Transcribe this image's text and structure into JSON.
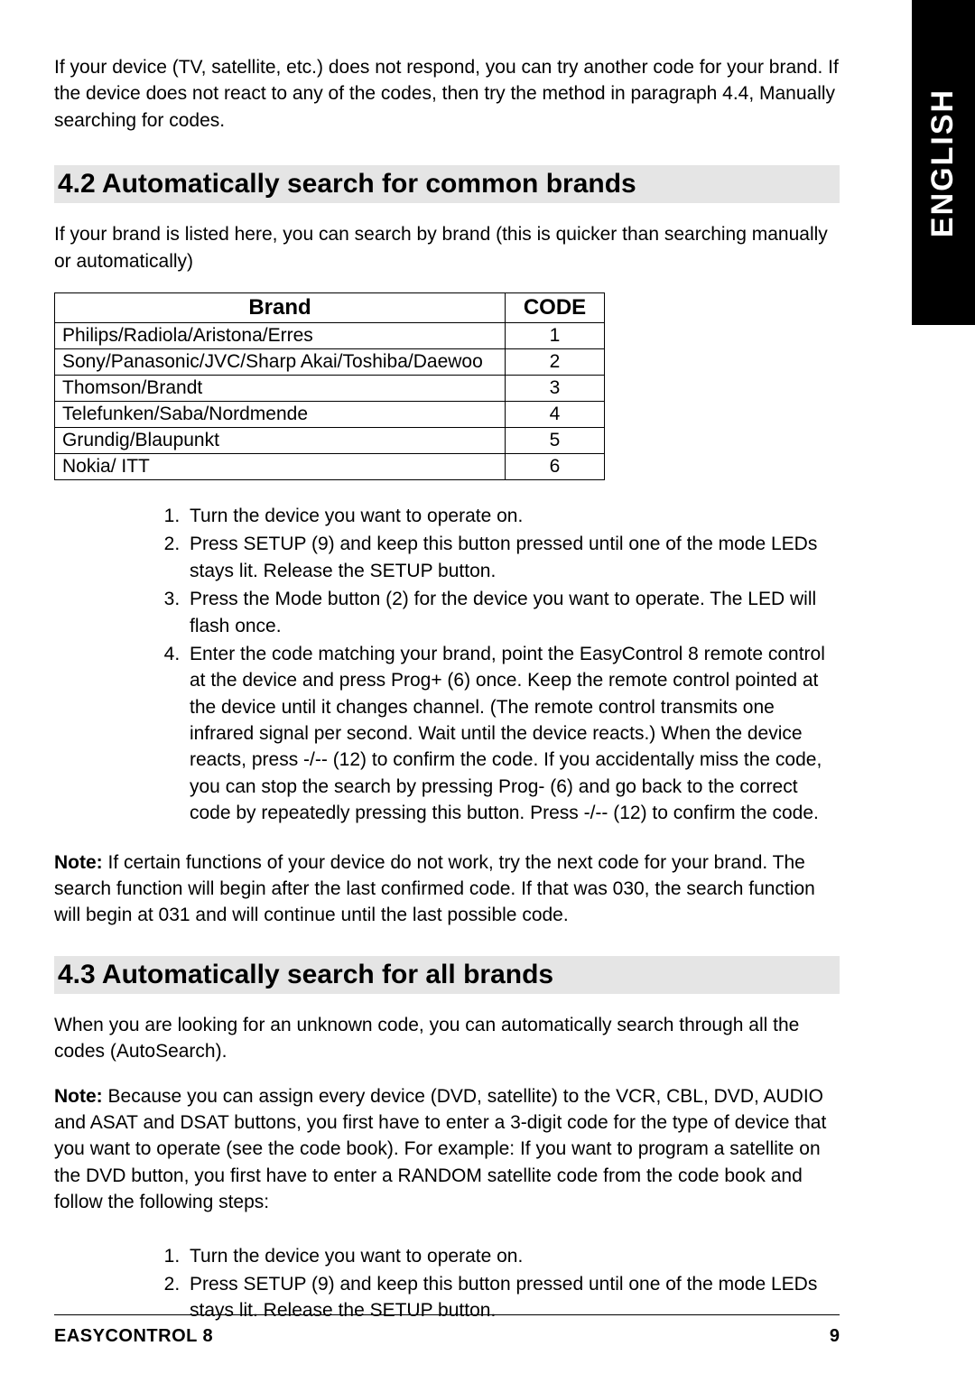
{
  "side_tab": "ENGLISH",
  "intro": "If your device (TV, satellite, etc.) does not respond, you can try another code for your brand. If the device does not react to any of the codes, then try the method in paragraph 4.4, Manually searching for codes.",
  "section_4_2": {
    "heading": "4.2 Automatically search for common brands",
    "intro": "If your brand is listed here, you can search by brand (this is quicker than searching manually or automatically)",
    "table": {
      "headers": {
        "brand": "Brand",
        "code": "CODE"
      },
      "rows": [
        {
          "brand": "Philips/Radiola/Aristona/Erres",
          "code": "1"
        },
        {
          "brand": "Sony/Panasonic/JVC/Sharp Akai/Toshiba/Daewoo",
          "code": "2"
        },
        {
          "brand": "Thomson/Brandt",
          "code": "3"
        },
        {
          "brand": "Telefunken/Saba/Nordmende",
          "code": "4"
        },
        {
          "brand": "Grundig/Blaupunkt",
          "code": "5"
        },
        {
          "brand": "Nokia/ ITT",
          "code": "6"
        }
      ]
    },
    "steps": [
      "Turn the device you want to operate on.",
      "Press SETUP (9) and keep this button pressed until one of the mode LEDs stays lit. Release the SETUP button.",
      "Press the Mode button (2) for the device you want to operate. The LED will flash once.",
      "Enter the code matching your brand, point the EasyControl 8 remote control at the device and press Prog+ (6) once. Keep the remote control pointed at the device until it changes channel. (The remote control transmits one infrared signal per second. Wait until the device reacts.) When the device reacts, press -/-- (12) to confirm the code. If you accidentally miss the code, you can stop the search by pressing Prog- (6) and go back to the correct code by repeatedly pressing this button. Press -/-- (12) to confirm the code."
    ],
    "note_label": "Note:",
    "note": " If certain functions of your device do not work, try the next code for your brand. The search function will begin after the last confirmed code. If that was 030, the search function will begin at 031 and will continue until the last possible code."
  },
  "section_4_3": {
    "heading": "4.3 Automatically search for all brands",
    "intro": "When you are looking for an unknown code, you can automatically search through all the codes (AutoSearch).",
    "note_label": "Note:",
    "note": " Because you can assign every device (DVD, satellite) to the VCR, CBL, DVD, AUDIO and ASAT and DSAT buttons, you first have to enter a 3-digit code for the type of device that you want to operate (see the code book). For example: If you want to program a satellite on the DVD button, you first have to enter a RANDOM satellite code from the code book and follow the following steps:",
    "steps": [
      "Turn the device you want to operate on.",
      "Press SETUP (9) and keep this button pressed until one of the mode LEDs stays lit. Release the SETUP button."
    ]
  },
  "footer": {
    "left": "EASYCONTROL 8",
    "right": "9"
  }
}
